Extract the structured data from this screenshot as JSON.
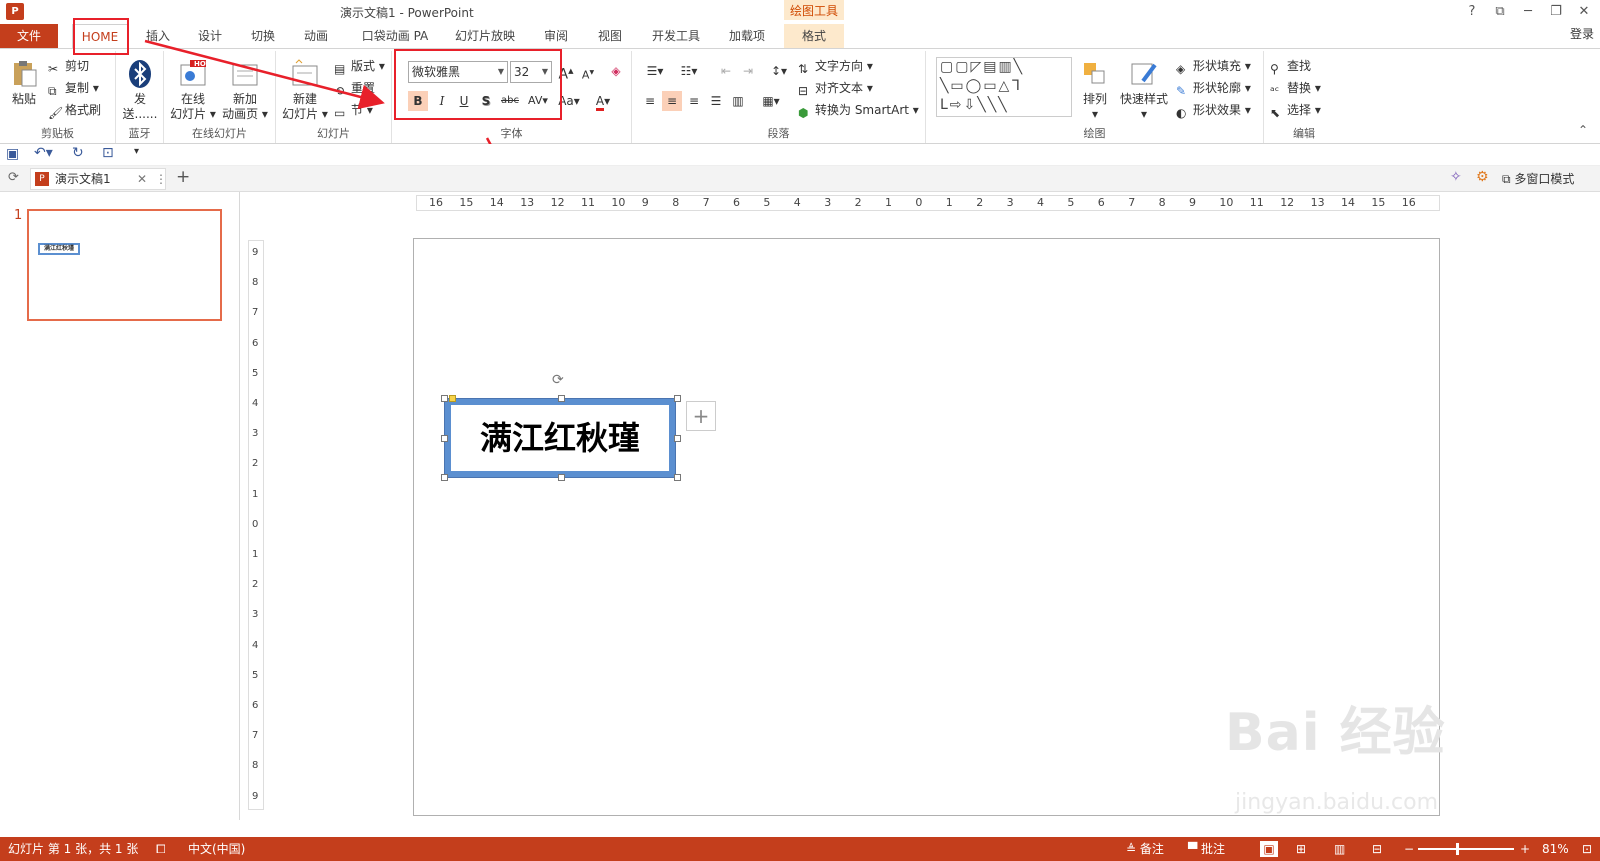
{
  "titlebar": {
    "app_icon": "P",
    "title": "演示文稿1 - PowerPoint",
    "context_header": "绘图工具",
    "help": "?",
    "login": "登录"
  },
  "tabs": [
    {
      "label": "文件"
    },
    {
      "label": "HOME"
    },
    {
      "label": "插入"
    },
    {
      "label": "设计"
    },
    {
      "label": "切换"
    },
    {
      "label": "动画"
    },
    {
      "label": "口袋动画 PA"
    },
    {
      "label": "幻灯片放映"
    },
    {
      "label": "审阅"
    },
    {
      "label": "视图"
    },
    {
      "label": "开发工具"
    },
    {
      "label": "加载项"
    },
    {
      "label": "格式"
    }
  ],
  "ribbon": {
    "clipboard": {
      "group": "剪贴板",
      "paste": "粘贴",
      "cut": "剪切",
      "copy": "复制",
      "format_painter": "格式刷"
    },
    "bluetooth": {
      "group": "蓝牙",
      "send": "发送......",
      "send1": "发",
      "send2": "送......"
    },
    "online": {
      "group": "在线幻灯片",
      "online_slide1": "在线",
      "online_slide2": "幻灯片",
      "new_anim1": "新加",
      "new_anim2": "动画页",
      "hot": "HOT"
    },
    "slides": {
      "group": "幻灯片",
      "new_slide1": "新建",
      "new_slide2": "幻灯片",
      "layout": "版式",
      "reset": "重置",
      "section": "节"
    },
    "font": {
      "group": "字体",
      "font_name": "微软雅黑",
      "font_size": "32",
      "bold": "B",
      "italic": "I",
      "underline": "U",
      "shadow": "S",
      "strike": "abc",
      "spacing": "AV",
      "case": "Aa",
      "color": "A"
    },
    "paragraph": {
      "group": "段落",
      "text_direction": "文字方向",
      "align_text": "对齐文本",
      "smartart": "转换为 SmartArt"
    },
    "drawing": {
      "group": "绘图",
      "arrange": "排列",
      "quick_styles": "快速样式",
      "shape_fill": "形状填充",
      "shape_outline": "形状轮廓",
      "shape_effects": "形状效果"
    },
    "editing": {
      "group": "编辑",
      "find": "查找",
      "replace": "替换",
      "select": "选择"
    }
  },
  "doctab": {
    "name": "演示文稿1",
    "multiwindow": "多窗口模式"
  },
  "thumbnail": {
    "number": "1",
    "text": "满江红秋瑾"
  },
  "hruler_labels": [
    "16",
    "15",
    "14",
    "13",
    "12",
    "11",
    "10",
    "9",
    "8",
    "7",
    "6",
    "5",
    "4",
    "3",
    "2",
    "1",
    "0",
    "1",
    "2",
    "3",
    "4",
    "5",
    "6",
    "7",
    "8",
    "9",
    "10",
    "11",
    "12",
    "13",
    "14",
    "15",
    "16"
  ],
  "vruler_labels": [
    "9",
    "8",
    "7",
    "6",
    "5",
    "4",
    "3",
    "2",
    "1",
    "0",
    "1",
    "2",
    "3",
    "4",
    "5",
    "6",
    "7",
    "8",
    "9"
  ],
  "slide": {
    "text": "满江红秋瑾"
  },
  "statusbar": {
    "slide_info": "幻灯片 第 1 张，共 1 张",
    "language": "中文(中国)",
    "notes": "备注",
    "comments": "批注",
    "zoom": "81%"
  },
  "watermark": {
    "brand": "Bai 经验",
    "url": "jingyan.baidu.com"
  },
  "colors": {
    "accent": "#c43e1c",
    "annotation": "#e8202a",
    "shape_border": "#5b8fd0"
  }
}
